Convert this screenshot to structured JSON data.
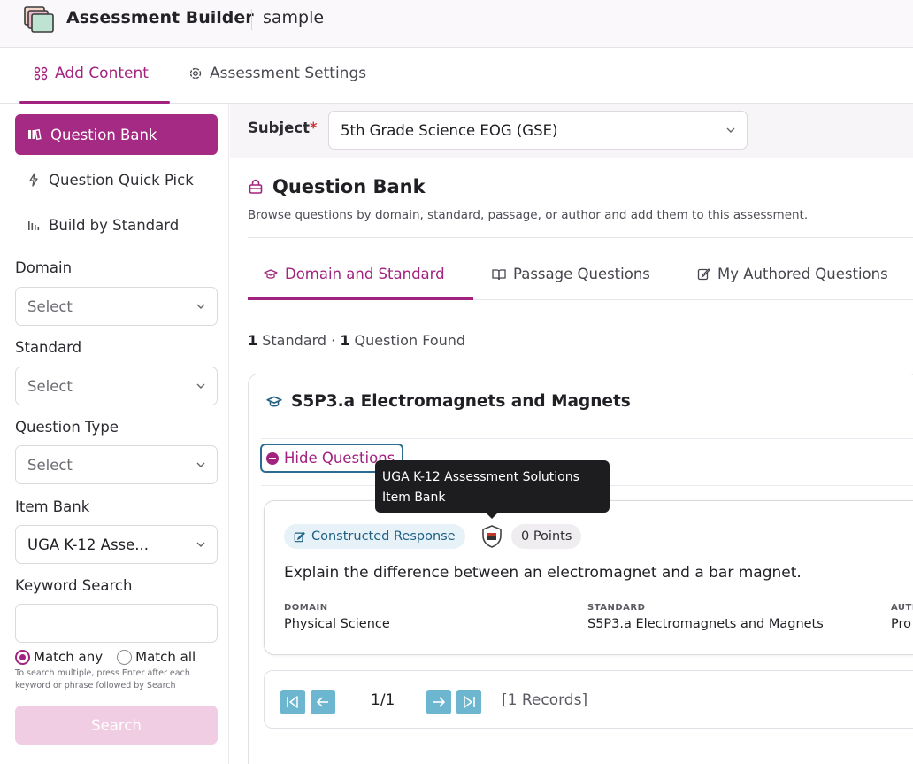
{
  "header": {
    "app_title": "Assessment Builder",
    "doc_name": "sample",
    "logo_icon": "stacked-books-icon"
  },
  "main_nav": {
    "tabs": [
      {
        "label": "Add Content",
        "icon": "grid-icon",
        "active": true
      },
      {
        "label": "Assessment Settings",
        "icon": "gear-icon",
        "active": false
      }
    ]
  },
  "sidebar": {
    "modes": [
      {
        "label": "Question Bank",
        "icon": "books-icon",
        "active": true
      },
      {
        "label": "Question Quick Pick",
        "icon": "lightning-icon",
        "active": false
      },
      {
        "label": "Build by Standard",
        "icon": "bars-icon",
        "active": false
      }
    ],
    "filters": {
      "domain": {
        "label": "Domain",
        "value": "Select"
      },
      "standard": {
        "label": "Standard",
        "value": "Select"
      },
      "question_type": {
        "label": "Question Type",
        "value": "Select"
      },
      "item_bank": {
        "label": "Item Bank",
        "value": "UGA K-12 Asse..."
      },
      "keyword": {
        "label": "Keyword Search",
        "value": ""
      }
    },
    "match_any": "Match any",
    "match_all": "Match all",
    "match_selected": "any",
    "hint": "To search multiple, press Enter after each keyword or phrase followed by Search",
    "search_button": "Search"
  },
  "subject": {
    "label": "Subject",
    "required_mark": "*",
    "value": "5th Grade Science EOG (GSE)"
  },
  "question_bank": {
    "title": "Question Bank",
    "description": "Browse questions by domain, standard, passage, or author and add them to this assessment.",
    "tabs": [
      {
        "label": "Domain and Standard",
        "icon": "graduation-cap-icon",
        "active": true
      },
      {
        "label": "Passage Questions",
        "icon": "open-book-icon",
        "active": false
      },
      {
        "label": "My Authored Questions",
        "icon": "edit-icon",
        "active": false
      }
    ],
    "found": {
      "standards_count": "1",
      "standards_label": "Standard",
      "separator": "·",
      "questions_count": "1",
      "questions_label": "Question Found"
    }
  },
  "standard_card": {
    "title": "S5P3.a Electromagnets and Magnets",
    "hide_button": "Hide Questions",
    "question": {
      "type": "Constructed Response",
      "points": "0 Points",
      "text": "Explain the difference between an electromagnet and a bar magnet.",
      "domain_label": "DOMAIN",
      "domain_value": "Physical Science",
      "standard_label": "STANDARD",
      "standard_value": "S5P3.a Electromagnets and Magnets",
      "author_label": "AUTH",
      "author_value": "Pro"
    },
    "pagination": {
      "page": "1/1",
      "records": "[1 Records]"
    }
  },
  "tooltip": {
    "line1": "UGA K-12 Assessment Solutions",
    "line2": "Item Bank"
  },
  "colors": {
    "accent": "#a2237f",
    "active_side_bg": "#a52a83",
    "badge_blue_bg": "#e6f1f8",
    "pager_button": "#6cb6cf"
  }
}
